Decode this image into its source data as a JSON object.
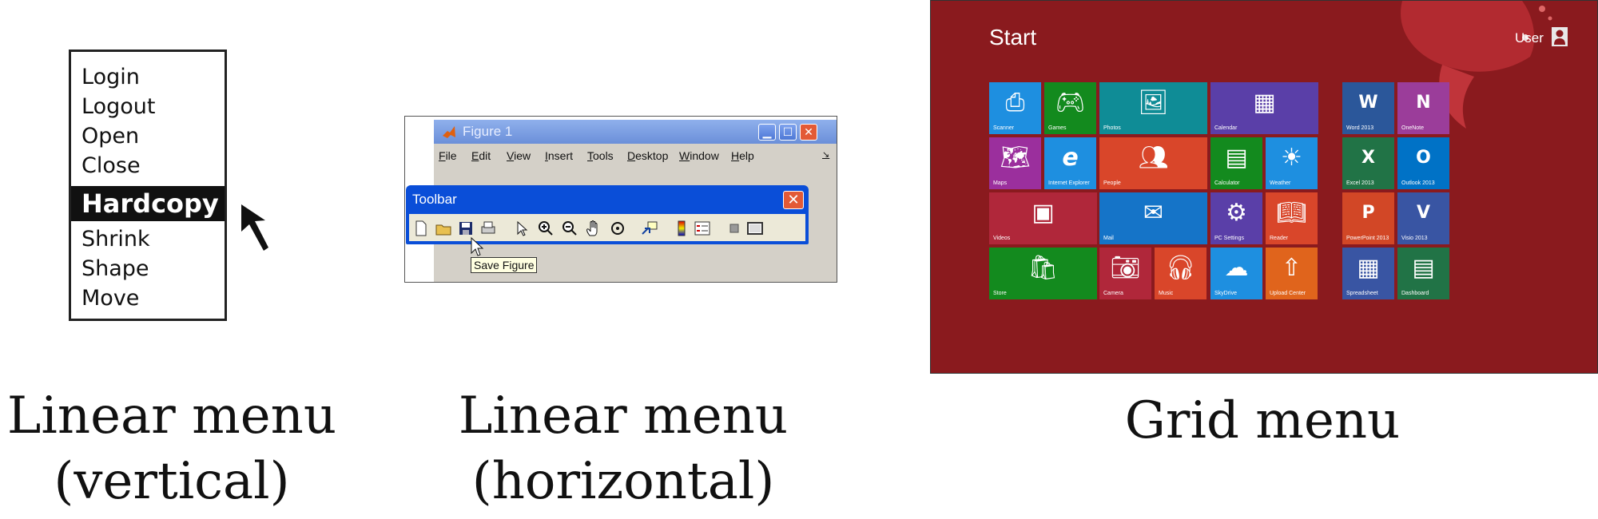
{
  "vertical_menu": {
    "items": [
      "Login",
      "Logout",
      "Open",
      "Close",
      "Hardcopy",
      "Shrink",
      "Shape",
      "Move"
    ],
    "selected": "Hardcopy"
  },
  "figure_window": {
    "title": "Figure 1",
    "menubar": [
      "File",
      "Edit",
      "View",
      "Insert",
      "Tools",
      "Desktop",
      "Window",
      "Help"
    ]
  },
  "toolbar": {
    "title": "Toolbar",
    "icons": [
      "new-figure-icon",
      "open-file-icon",
      "save-figure-icon",
      "print-icon",
      "select-arrow-icon",
      "zoom-in-icon",
      "zoom-out-icon",
      "pan-hand-icon",
      "rotate-3d-icon",
      "data-cursor-icon",
      "colorbar-icon",
      "legend-icon",
      "hide-plot-tools-icon",
      "show-plot-tools-icon"
    ],
    "tooltip": "Save Figure"
  },
  "start_screen": {
    "title": "Start",
    "user": "User",
    "background": "#8a1a1e",
    "tiles": [
      {
        "label": "Scanner",
        "color": "#1e8fe0",
        "icon": "scanner-icon"
      },
      {
        "label": "Games",
        "color": "#138a1e",
        "icon": "gamepad-icon"
      },
      {
        "label": "Photos",
        "color": "#0f8c96",
        "icon": "photo-icon"
      },
      {
        "label": "Calendar",
        "color": "#5a3fa8",
        "icon": "calendar-icon"
      },
      {
        "label": "Maps",
        "color": "#9b2f9d",
        "icon": "map-icon"
      },
      {
        "label": "Internet Explorer",
        "color": "#1e8fe0",
        "icon": "internet-explorer-icon"
      },
      {
        "label": "People",
        "color": "#d9462a",
        "icon": "people-icon"
      },
      {
        "label": "Calculator",
        "color": "#138a1e",
        "icon": "calculator-icon"
      },
      {
        "label": "Weather",
        "color": "#1e8fe0",
        "icon": "sun-icon"
      },
      {
        "label": "Videos",
        "color": "#b0273a",
        "icon": "video-icon"
      },
      {
        "label": "Mail",
        "color": "#1574c8",
        "icon": "mail-icon"
      },
      {
        "label": "PC Settings",
        "color": "#5a3fa8",
        "icon": "gear-icon"
      },
      {
        "label": "Reader",
        "color": "#d9462a",
        "icon": "reader-icon"
      },
      {
        "label": "Store",
        "color": "#138a1e",
        "icon": "store-icon"
      },
      {
        "label": "Camera",
        "color": "#b0273a",
        "icon": "camera-icon"
      },
      {
        "label": "Music",
        "color": "#d9462a",
        "icon": "headphones-icon"
      },
      {
        "label": "SkyDrive",
        "color": "#1e8fe0",
        "icon": "cloud-icon"
      },
      {
        "label": "Upload Center",
        "color": "#e0641c",
        "icon": "upload-icon"
      },
      {
        "label": "Word 2013",
        "color": "#2b579a",
        "icon": "word-icon"
      },
      {
        "label": "OneNote",
        "color": "#9b3d9a",
        "icon": "onenote-icon"
      },
      {
        "label": "Excel 2013",
        "color": "#217346",
        "icon": "excel-icon"
      },
      {
        "label": "Outlook 2013",
        "color": "#0072c6",
        "icon": "outlook-icon"
      },
      {
        "label": "PowerPoint 2013",
        "color": "#d24726",
        "icon": "powerpoint-icon"
      },
      {
        "label": "Visio 2013",
        "color": "#3955a3",
        "icon": "visio-icon"
      },
      {
        "label": "Spreadsheet",
        "color": "#3955a3",
        "icon": "spreadsheet-icon"
      },
      {
        "label": "Dashboard",
        "color": "#217346",
        "icon": "dashboard-icon"
      }
    ]
  },
  "captions": [
    {
      "line1": "Linear menu",
      "line2": "(vertical)"
    },
    {
      "line1": "Linear menu",
      "line2": "(horizontal)"
    },
    {
      "line1": "Grid menu",
      "line2": ""
    }
  ]
}
